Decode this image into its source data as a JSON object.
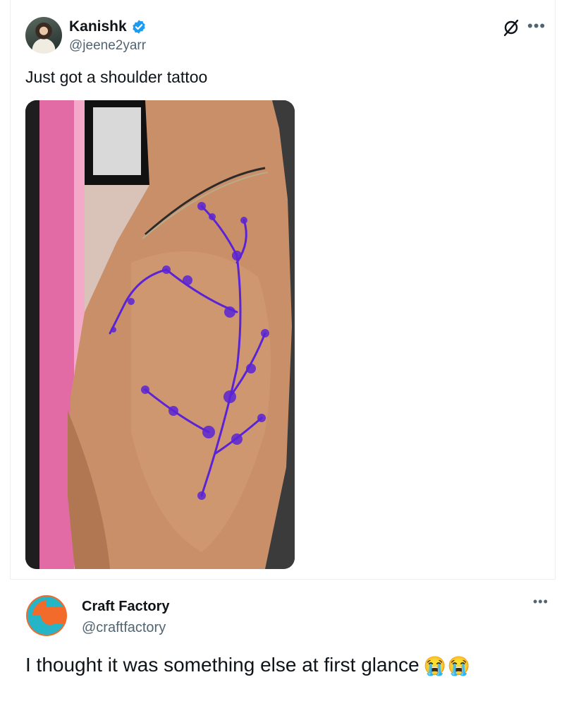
{
  "tweet": {
    "author_name": "Kanishk",
    "author_handle": "@jeene2yarr",
    "text": "Just got a shoulder tattoo",
    "more_label": "•••",
    "verified_color": "#1d9bf0"
  },
  "reply": {
    "author_name": "Craft Factory",
    "author_handle": "@craftfactory",
    "text": "I thought it was something else at first glance",
    "more_label": "•••",
    "emojis": [
      "😭",
      "😭"
    ]
  },
  "colors": {
    "text_primary": "#0f1419",
    "text_secondary": "#536471",
    "tattoo_ink": "#5a24d6",
    "logo_orange": "#f26b2a",
    "logo_teal": "#26b5c6"
  }
}
